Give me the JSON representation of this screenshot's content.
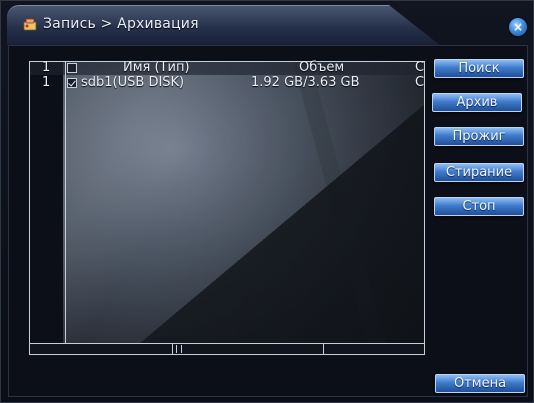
{
  "window": {
    "title": "Запись > Архивация",
    "close_glyph": "×",
    "title_icon": "record-archive-icon"
  },
  "table": {
    "header": {
      "index": "1",
      "name_type": "Имя (Тип)",
      "volume": "Объем",
      "extra": "С"
    },
    "rows": [
      {
        "index": "1",
        "checked": true,
        "name_type": "sdb1(USB DISK)",
        "volume": "1.92 GB/3.63 GB",
        "extra": "С"
      }
    ]
  },
  "buttons": {
    "search": "Поиск",
    "archive": "Архив",
    "burn": "Прожиг",
    "erase": "Стирание",
    "stop": "Стоп",
    "cancel": "Отмена"
  },
  "colors": {
    "button_top": "#8ebef4",
    "button_bottom": "#214f95",
    "grid_line": "#c8cfdc",
    "background": "#0c0f17"
  }
}
